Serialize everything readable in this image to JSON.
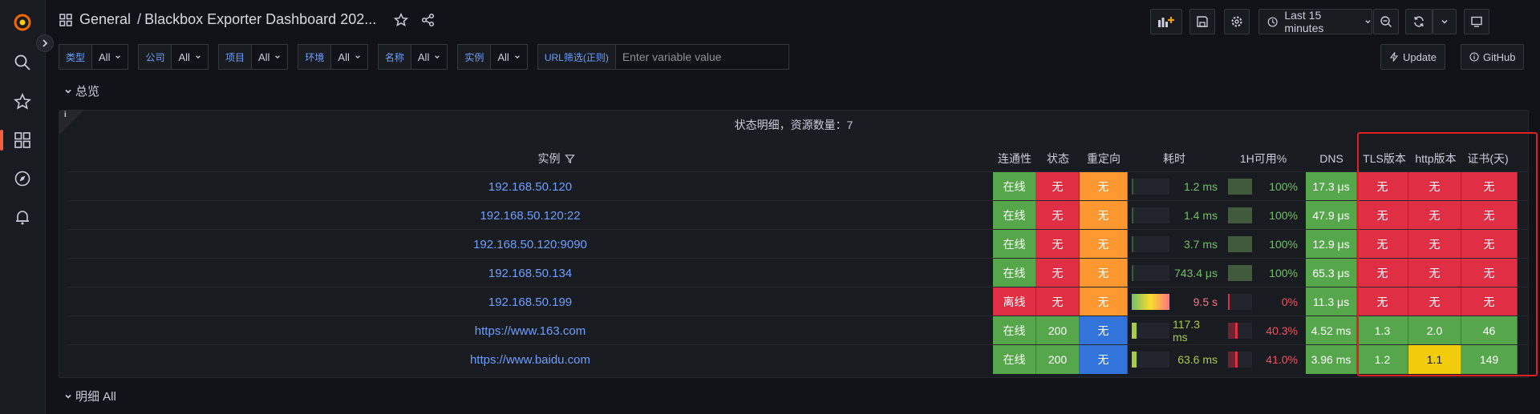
{
  "breadcrumb": {
    "folder": "General",
    "separator": "/",
    "title": "Blackbox Exporter Dashboard 202..."
  },
  "toolbar": {
    "time_range": "Last 15 minutes"
  },
  "variables": [
    {
      "label": "类型",
      "value": "All"
    },
    {
      "label": "公司",
      "value": "All"
    },
    {
      "label": "项目",
      "value": "All"
    },
    {
      "label": "环境",
      "value": "All"
    },
    {
      "label": "名称",
      "value": "All"
    },
    {
      "label": "实例",
      "value": "All"
    }
  ],
  "url_filter": {
    "label": "URL筛选(正则)",
    "placeholder": "Enter variable value"
  },
  "links": {
    "update": "Update",
    "github": "GitHub"
  },
  "rows": {
    "overview": "总览",
    "detail": "明细 All"
  },
  "panel": {
    "info": "i",
    "title": "状态明细，资源数量：7",
    "headers": [
      "实例",
      "连通性",
      "状态",
      "重定向",
      "耗时",
      "1H可用%",
      "DNS",
      "TLS版本",
      "http版本",
      "证书(天)"
    ],
    "rows": [
      {
        "instance": "192.168.50.120",
        "conn": "在线",
        "status": "无",
        "redirect": "无",
        "duration": "1.2 ms",
        "duration_frac": 0.01,
        "avail": "100%",
        "avail_frac": 1.0,
        "dns": "17.3 μs",
        "tls": "无",
        "http": "无",
        "cert": "无"
      },
      {
        "instance": "192.168.50.120:22",
        "conn": "在线",
        "status": "无",
        "redirect": "无",
        "duration": "1.4 ms",
        "duration_frac": 0.01,
        "avail": "100%",
        "avail_frac": 1.0,
        "dns": "47.9 μs",
        "tls": "无",
        "http": "无",
        "cert": "无"
      },
      {
        "instance": "192.168.50.120:9090",
        "conn": "在线",
        "status": "无",
        "redirect": "无",
        "duration": "3.7 ms",
        "duration_frac": 0.01,
        "avail": "100%",
        "avail_frac": 1.0,
        "dns": "12.9 μs",
        "tls": "无",
        "http": "无",
        "cert": "无"
      },
      {
        "instance": "192.168.50.134",
        "conn": "在线",
        "status": "无",
        "redirect": "无",
        "duration": "743.4 μs",
        "duration_frac": 0.0,
        "avail": "100%",
        "avail_frac": 1.0,
        "dns": "65.3 μs",
        "tls": "无",
        "http": "无",
        "cert": "无"
      },
      {
        "instance": "192.168.50.199",
        "conn": "离线",
        "status": "无",
        "redirect": "无",
        "duration": "9.5 s",
        "duration_frac": 1.0,
        "avail": "0%",
        "avail_frac": 0.0,
        "dns": "11.3 μs",
        "tls": "无",
        "http": "无",
        "cert": "无"
      },
      {
        "instance": "https://www.163.com",
        "conn": "在线",
        "status": "200",
        "redirect": "无",
        "duration": "117.3 ms",
        "duration_frac": 0.12,
        "avail": "40.3%",
        "avail_frac": 0.403,
        "dns": "4.52 ms",
        "tls": "1.3",
        "http": "2.0",
        "cert": "46"
      },
      {
        "instance": "https://www.baidu.com",
        "conn": "在线",
        "status": "200",
        "redirect": "无",
        "duration": "63.6 ms",
        "duration_frac": 0.12,
        "avail": "41.0%",
        "avail_frac": 0.41,
        "dns": "3.96 ms",
        "tls": "1.2",
        "http": "1.1",
        "cert": "149"
      }
    ]
  },
  "colors": {
    "green": "#56a64b",
    "red": "#e02f44",
    "orange": "#ff9830",
    "blue": "#3274d9",
    "yellow": "#f2cc0c",
    "accent": "#6e9fff"
  }
}
